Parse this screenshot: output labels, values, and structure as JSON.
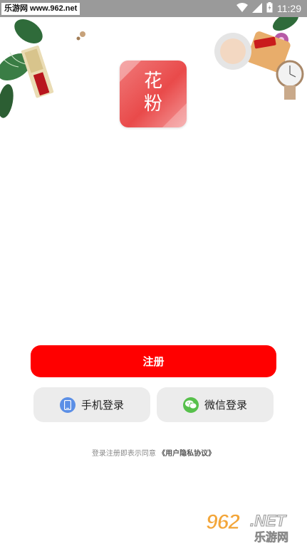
{
  "status_bar": {
    "watermark": "乐游网 www.962.net",
    "time": "11:29"
  },
  "logo": {
    "line1": "花",
    "line2": "粉"
  },
  "register_label": "注册",
  "phone_login_label": "手机登录",
  "wechat_login_label": "微信登录",
  "agreement": {
    "prefix": "登录注册即表示同意",
    "link": "《用户隐私协议》"
  },
  "watermark": {
    "number": "962",
    "domain": ".NET",
    "name": "乐游网"
  },
  "colors": {
    "primary": "#ff0000",
    "secondary_button_bg": "#ececec",
    "phone_icon": "#5b8fe6",
    "wechat_icon": "#57c04b"
  },
  "icons": [
    "wifi-icon",
    "signal-icon",
    "battery-icon",
    "phone-icon",
    "wechat-icon"
  ]
}
